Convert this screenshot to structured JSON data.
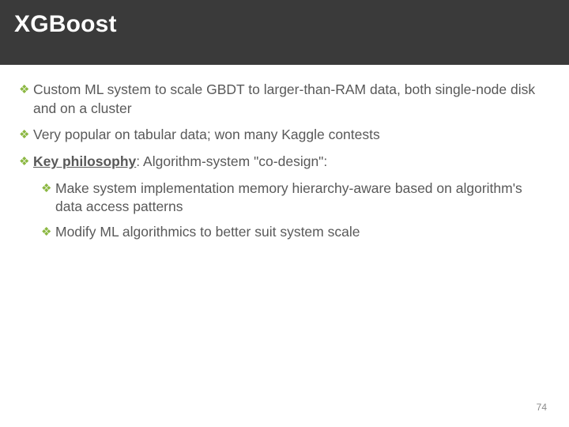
{
  "header": {
    "title": "XGBoost"
  },
  "bullets": [
    {
      "text": "Custom ML system to scale GBDT to larger-than-RAM data, both single-node disk and on a cluster"
    },
    {
      "text": "Very popular on tabular data; won many Kaggle contests"
    },
    {
      "label_bold_underline": "Key philosophy",
      "rest": ": Algorithm-system \"co-design\":",
      "sub": [
        {
          "text": "Make system implementation memory hierarchy-aware based on algorithm's data access patterns"
        },
        {
          "text": "Modify ML algorithmics to better suit system scale"
        }
      ]
    }
  ],
  "page_number": "74",
  "bullet_glyph": "❖"
}
